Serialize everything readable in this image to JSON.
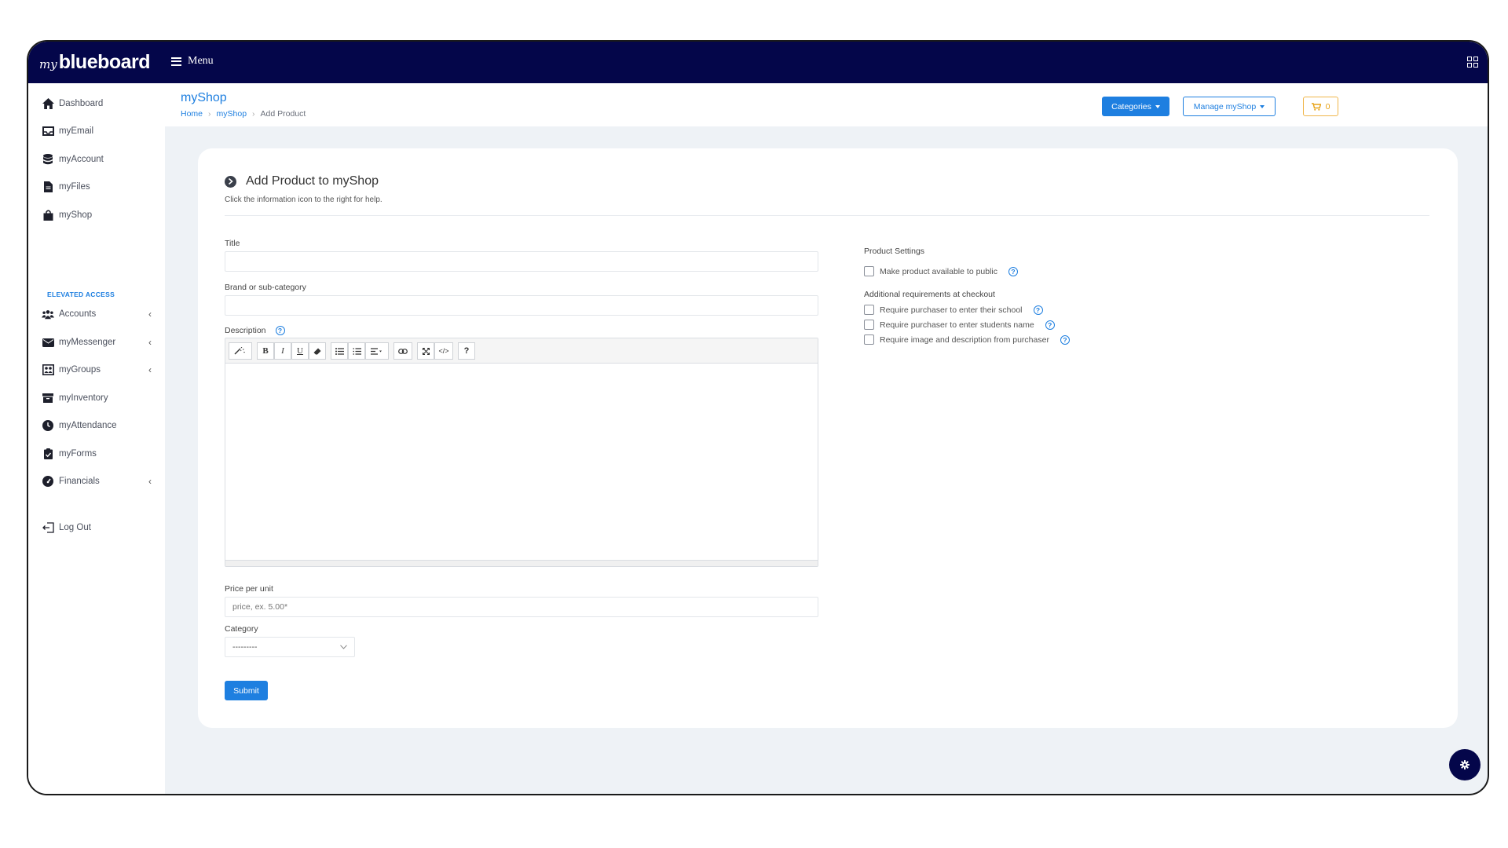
{
  "brand": {
    "prefix": "my",
    "name": "blueboard"
  },
  "topbar": {
    "menu_label": "Menu"
  },
  "sidebar": {
    "items": [
      {
        "label": "Dashboard"
      },
      {
        "label": "myEmail"
      },
      {
        "label": "myAccount"
      },
      {
        "label": "myFiles"
      },
      {
        "label": "myShop"
      }
    ],
    "section_label": "ELEVATED ACCESS",
    "elevated_items": [
      {
        "label": "Accounts"
      },
      {
        "label": "myMessenger"
      },
      {
        "label": "myGroups"
      },
      {
        "label": "myInventory"
      },
      {
        "label": "myAttendance"
      },
      {
        "label": "myForms"
      },
      {
        "label": "Financials"
      }
    ],
    "logout_label": "Log Out"
  },
  "header": {
    "title": "myShop",
    "breadcrumb": [
      "Home",
      "myShop",
      "Add Product"
    ],
    "categories_label": "Categories",
    "manage_label": "Manage myShop",
    "cart_count": "0"
  },
  "form": {
    "heading": "Add Product to myShop",
    "subheading": "Click the information icon to the right for help.",
    "title_label": "Title",
    "title_value": "",
    "brand_label": "Brand or sub-category",
    "brand_value": "",
    "description_label": "Description",
    "price_label": "Price per unit",
    "price_placeholder": "price, ex. 5.00*",
    "category_label": "Category",
    "category_selected": "---------",
    "submit_label": "Submit"
  },
  "settings": {
    "heading": "Product Settings",
    "public_label": "Make product available to public",
    "checkout_heading": "Additional requirements at checkout",
    "checkout_options": [
      {
        "label": "Require purchaser to enter their school"
      },
      {
        "label": "Require purchaser to enter students name"
      },
      {
        "label": "Require image and description from purchaser"
      }
    ]
  },
  "colors": {
    "navbar": "#04064a",
    "accent": "#1e7fe0",
    "cart": "#e8a317"
  }
}
